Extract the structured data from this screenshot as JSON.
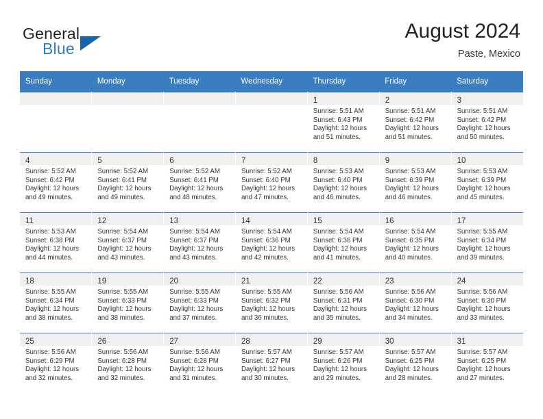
{
  "brand": {
    "name_top": "General",
    "name_bottom": "Blue",
    "triangle_color": "#1565ab",
    "blue_color": "#2e7dc4"
  },
  "header": {
    "title": "August 2024",
    "subtitle": "Paste, Mexico"
  },
  "theme": {
    "header_bar": "#3a7dc0",
    "daynum_band": "#efefef",
    "text": "#333333"
  },
  "weekday_headers": [
    "Sunday",
    "Monday",
    "Tuesday",
    "Wednesday",
    "Thursday",
    "Friday",
    "Saturday"
  ],
  "labels": {
    "sunrise_prefix": "Sunrise:",
    "sunset_prefix": "Sunset:",
    "daylight_prefix": "Daylight:"
  },
  "weeks": [
    [
      {
        "day": "",
        "empty": true
      },
      {
        "day": "",
        "empty": true
      },
      {
        "day": "",
        "empty": true
      },
      {
        "day": "",
        "empty": true
      },
      {
        "day": "1",
        "sunrise": "Sunrise: 5:51 AM",
        "sunset": "Sunset: 6:43 PM",
        "daylight_line1": "Daylight: 12 hours",
        "daylight_line2": "and 51 minutes."
      },
      {
        "day": "2",
        "sunrise": "Sunrise: 5:51 AM",
        "sunset": "Sunset: 6:42 PM",
        "daylight_line1": "Daylight: 12 hours",
        "daylight_line2": "and 51 minutes."
      },
      {
        "day": "3",
        "sunrise": "Sunrise: 5:51 AM",
        "sunset": "Sunset: 6:42 PM",
        "daylight_line1": "Daylight: 12 hours",
        "daylight_line2": "and 50 minutes."
      }
    ],
    [
      {
        "day": "4",
        "sunrise": "Sunrise: 5:52 AM",
        "sunset": "Sunset: 6:42 PM",
        "daylight_line1": "Daylight: 12 hours",
        "daylight_line2": "and 49 minutes."
      },
      {
        "day": "5",
        "sunrise": "Sunrise: 5:52 AM",
        "sunset": "Sunset: 6:41 PM",
        "daylight_line1": "Daylight: 12 hours",
        "daylight_line2": "and 49 minutes."
      },
      {
        "day": "6",
        "sunrise": "Sunrise: 5:52 AM",
        "sunset": "Sunset: 6:41 PM",
        "daylight_line1": "Daylight: 12 hours",
        "daylight_line2": "and 48 minutes."
      },
      {
        "day": "7",
        "sunrise": "Sunrise: 5:52 AM",
        "sunset": "Sunset: 6:40 PM",
        "daylight_line1": "Daylight: 12 hours",
        "daylight_line2": "and 47 minutes."
      },
      {
        "day": "8",
        "sunrise": "Sunrise: 5:53 AM",
        "sunset": "Sunset: 6:40 PM",
        "daylight_line1": "Daylight: 12 hours",
        "daylight_line2": "and 46 minutes."
      },
      {
        "day": "9",
        "sunrise": "Sunrise: 5:53 AM",
        "sunset": "Sunset: 6:39 PM",
        "daylight_line1": "Daylight: 12 hours",
        "daylight_line2": "and 46 minutes."
      },
      {
        "day": "10",
        "sunrise": "Sunrise: 5:53 AM",
        "sunset": "Sunset: 6:39 PM",
        "daylight_line1": "Daylight: 12 hours",
        "daylight_line2": "and 45 minutes."
      }
    ],
    [
      {
        "day": "11",
        "sunrise": "Sunrise: 5:53 AM",
        "sunset": "Sunset: 6:38 PM",
        "daylight_line1": "Daylight: 12 hours",
        "daylight_line2": "and 44 minutes."
      },
      {
        "day": "12",
        "sunrise": "Sunrise: 5:54 AM",
        "sunset": "Sunset: 6:37 PM",
        "daylight_line1": "Daylight: 12 hours",
        "daylight_line2": "and 43 minutes."
      },
      {
        "day": "13",
        "sunrise": "Sunrise: 5:54 AM",
        "sunset": "Sunset: 6:37 PM",
        "daylight_line1": "Daylight: 12 hours",
        "daylight_line2": "and 43 minutes."
      },
      {
        "day": "14",
        "sunrise": "Sunrise: 5:54 AM",
        "sunset": "Sunset: 6:36 PM",
        "daylight_line1": "Daylight: 12 hours",
        "daylight_line2": "and 42 minutes."
      },
      {
        "day": "15",
        "sunrise": "Sunrise: 5:54 AM",
        "sunset": "Sunset: 6:36 PM",
        "daylight_line1": "Daylight: 12 hours",
        "daylight_line2": "and 41 minutes."
      },
      {
        "day": "16",
        "sunrise": "Sunrise: 5:54 AM",
        "sunset": "Sunset: 6:35 PM",
        "daylight_line1": "Daylight: 12 hours",
        "daylight_line2": "and 40 minutes."
      },
      {
        "day": "17",
        "sunrise": "Sunrise: 5:55 AM",
        "sunset": "Sunset: 6:34 PM",
        "daylight_line1": "Daylight: 12 hours",
        "daylight_line2": "and 39 minutes."
      }
    ],
    [
      {
        "day": "18",
        "sunrise": "Sunrise: 5:55 AM",
        "sunset": "Sunset: 6:34 PM",
        "daylight_line1": "Daylight: 12 hours",
        "daylight_line2": "and 38 minutes."
      },
      {
        "day": "19",
        "sunrise": "Sunrise: 5:55 AM",
        "sunset": "Sunset: 6:33 PM",
        "daylight_line1": "Daylight: 12 hours",
        "daylight_line2": "and 38 minutes."
      },
      {
        "day": "20",
        "sunrise": "Sunrise: 5:55 AM",
        "sunset": "Sunset: 6:33 PM",
        "daylight_line1": "Daylight: 12 hours",
        "daylight_line2": "and 37 minutes."
      },
      {
        "day": "21",
        "sunrise": "Sunrise: 5:55 AM",
        "sunset": "Sunset: 6:32 PM",
        "daylight_line1": "Daylight: 12 hours",
        "daylight_line2": "and 36 minutes."
      },
      {
        "day": "22",
        "sunrise": "Sunrise: 5:56 AM",
        "sunset": "Sunset: 6:31 PM",
        "daylight_line1": "Daylight: 12 hours",
        "daylight_line2": "and 35 minutes."
      },
      {
        "day": "23",
        "sunrise": "Sunrise: 5:56 AM",
        "sunset": "Sunset: 6:30 PM",
        "daylight_line1": "Daylight: 12 hours",
        "daylight_line2": "and 34 minutes."
      },
      {
        "day": "24",
        "sunrise": "Sunrise: 5:56 AM",
        "sunset": "Sunset: 6:30 PM",
        "daylight_line1": "Daylight: 12 hours",
        "daylight_line2": "and 33 minutes."
      }
    ],
    [
      {
        "day": "25",
        "sunrise": "Sunrise: 5:56 AM",
        "sunset": "Sunset: 6:29 PM",
        "daylight_line1": "Daylight: 12 hours",
        "daylight_line2": "and 32 minutes."
      },
      {
        "day": "26",
        "sunrise": "Sunrise: 5:56 AM",
        "sunset": "Sunset: 6:28 PM",
        "daylight_line1": "Daylight: 12 hours",
        "daylight_line2": "and 32 minutes."
      },
      {
        "day": "27",
        "sunrise": "Sunrise: 5:56 AM",
        "sunset": "Sunset: 6:28 PM",
        "daylight_line1": "Daylight: 12 hours",
        "daylight_line2": "and 31 minutes."
      },
      {
        "day": "28",
        "sunrise": "Sunrise: 5:57 AM",
        "sunset": "Sunset: 6:27 PM",
        "daylight_line1": "Daylight: 12 hours",
        "daylight_line2": "and 30 minutes."
      },
      {
        "day": "29",
        "sunrise": "Sunrise: 5:57 AM",
        "sunset": "Sunset: 6:26 PM",
        "daylight_line1": "Daylight: 12 hours",
        "daylight_line2": "and 29 minutes."
      },
      {
        "day": "30",
        "sunrise": "Sunrise: 5:57 AM",
        "sunset": "Sunset: 6:25 PM",
        "daylight_line1": "Daylight: 12 hours",
        "daylight_line2": "and 28 minutes."
      },
      {
        "day": "31",
        "sunrise": "Sunrise: 5:57 AM",
        "sunset": "Sunset: 6:25 PM",
        "daylight_line1": "Daylight: 12 hours",
        "daylight_line2": "and 27 minutes."
      }
    ]
  ]
}
